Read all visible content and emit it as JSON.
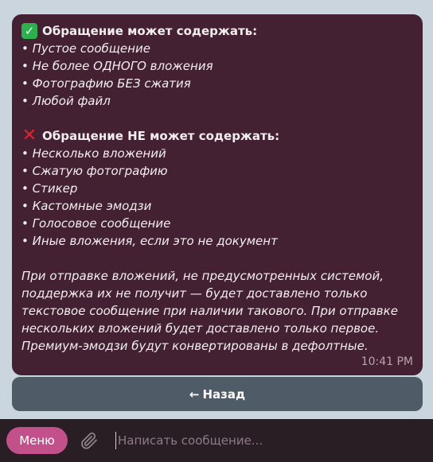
{
  "message": {
    "can_heading": "Обращение может содержать:",
    "can_items": [
      "• Пустое сообщение",
      "• Не более ОДНОГО вложения",
      "• Фотографию БЕЗ сжатия",
      "• Любой файл"
    ],
    "cannot_heading": "Обращение НЕ может содержать:",
    "cannot_items": [
      "• Несколько вложений",
      "• Сжатую фотографию",
      "• Стикер",
      "• Кастомные эмодзи",
      "• Голосовое сообщение",
      "• Иные вложения, если это не документ"
    ],
    "note_lines": [
      "При отправке вложений, не предусмотренных системой,",
      "поддержка их не получит — будет доставлено только",
      "текстовое сообщение при наличии такового. При отправке",
      "нескольких вложений будет доставлено только первое.",
      "Премиум-эмодзи будут конвертированы в дефолтные."
    ],
    "time": "10:41 PM"
  },
  "keyboard": {
    "back_arrow": "←",
    "back_label": "Назад"
  },
  "input_bar": {
    "menu_label": "Меню",
    "placeholder": "Написать сообщение..."
  },
  "icons": {
    "can": "check-mark-icon",
    "cannot": "cross-mark-icon",
    "attach": "paperclip-icon"
  },
  "colors": {
    "bubble": "#432132",
    "menu_button": "#c1508b",
    "back_button": "#4f5b66",
    "check": "#2db14e",
    "cross": "#e0242c"
  }
}
